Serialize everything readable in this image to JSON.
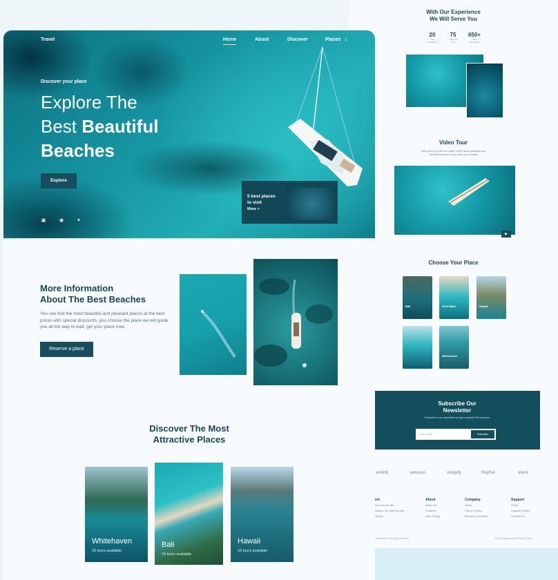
{
  "front": {
    "nav": {
      "brand": "Travel",
      "items": [
        "Home",
        "About",
        "Discover",
        "Places"
      ]
    },
    "hero": {
      "subtitle": "Discover your place",
      "title_line1": "Explore The",
      "title_line2_plain": "Best ",
      "title_line2_bold": "Beautiful",
      "title_line3": "Beaches",
      "button": "Explore",
      "best_title_1": "5 best places",
      "best_title_2": "to visit",
      "best_more": "More +"
    },
    "info": {
      "title_1": "More Information",
      "title_2": "About The Best Beaches",
      "text": "You can find the most beautiful and pleasant places at the best prices with special discounts, you choose the place we will guide you all the way to wait, get your place now.",
      "button": "Reserve a place"
    },
    "discover": {
      "title_1": "Discover The Most",
      "title_2": "Attractive Places",
      "places": [
        {
          "name": "Whitehaven",
          "tours": "32 tours available"
        },
        {
          "name": "Bali",
          "tours": "24 tours available"
        },
        {
          "name": "Hawaii",
          "tours": "15 tours available"
        }
      ]
    }
  },
  "back": {
    "experience": {
      "title_1": "With Our Experience",
      "title_2": "We Will Serve You",
      "stats": [
        {
          "value": "20",
          "label_1": "Year",
          "label_2": "Experience"
        },
        {
          "value": "75",
          "label_1": "Complete",
          "label_2": "tours"
        },
        {
          "value": "650+",
          "label_1": "Tourist",
          "label_2": "Destination"
        }
      ]
    },
    "video": {
      "title": "Video Tour",
      "text_1": "Find your trip with our video of the most beautiful and",
      "text_2": "pleasant places for you and your family."
    },
    "choose": {
      "title": "Choose Your Place",
      "cards": [
        "Bali",
        "Gina Baha",
        "Hawaii",
        "",
        "Whitehaven",
        ""
      ]
    },
    "newsletter": {
      "title_1": "Subscribe Our",
      "title_2": "Newsletter",
      "sub": "Subscribe to our newsletter and get a special 30% discount.",
      "placeholder": "Enter email",
      "button": "Subscribe"
    },
    "logos": [
      "airbnb",
      "amazon",
      "shopify",
      "PayPal",
      "slack"
    ],
    "footer": {
      "about": {
        "title": "About",
        "items": [
          "About Us",
          "Features",
          "New & Blog"
        ]
      },
      "company": {
        "title": "Company",
        "items": [
          "Team",
          "Plan y Pricing",
          "Become a member"
        ]
      },
      "support": {
        "title": "Support",
        "items": [
          "FAQs",
          "Support Center",
          "Contact Us"
        ]
      },
      "brand_title": "avel",
      "brand_text_1": "If you choose the",
      "brand_text_2": "stination, we offer you the",
      "brand_text_3": "p ahead.",
      "copyright": "@ Bedimcode. All rights reserved",
      "legal": "Terms & Agreements     Privacy Policy"
    }
  },
  "colors": {
    "primary": "#174E5D",
    "accent": "#1FA9B3",
    "background": "#F8FBFD"
  }
}
